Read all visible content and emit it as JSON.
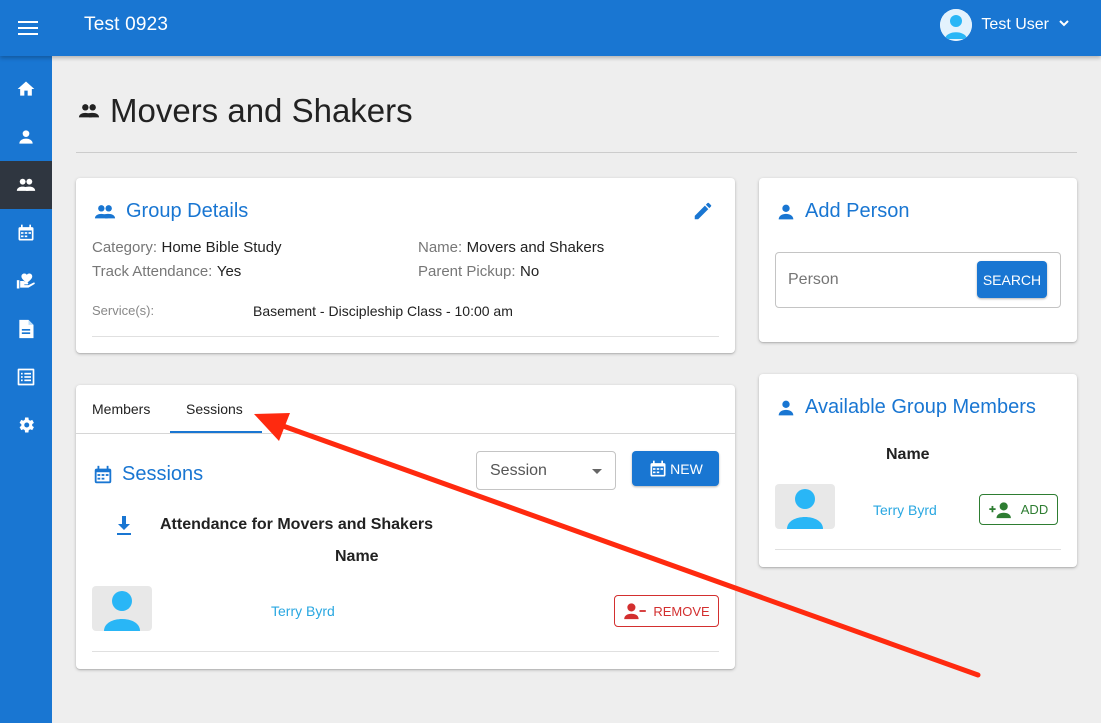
{
  "topbar": {
    "app_title": "Test 0923",
    "user_name": "Test User"
  },
  "sidebar": {
    "items": [
      {
        "name": "home",
        "active": false
      },
      {
        "name": "people",
        "active": false
      },
      {
        "name": "groups",
        "active": true
      },
      {
        "name": "attendance",
        "active": false
      },
      {
        "name": "donations",
        "active": false
      },
      {
        "name": "forms",
        "active": false
      },
      {
        "name": "reports",
        "active": false
      },
      {
        "name": "settings",
        "active": false
      }
    ]
  },
  "page": {
    "title": "Movers and Shakers"
  },
  "group_details": {
    "title": "Group Details",
    "category_label": "Category:",
    "category_value": "Home Bible Study",
    "name_label": "Name:",
    "name_value": "Movers and Shakers",
    "track_label": "Track Attendance:",
    "track_value": "Yes",
    "pickup_label": "Parent Pickup:",
    "pickup_value": "No",
    "services_label": "Service(s):",
    "services_value": "Basement - Discipleship Class - 10:00 am"
  },
  "tabs": {
    "members": "Members",
    "sessions": "Sessions",
    "active": "sessions"
  },
  "sessions_panel": {
    "title": "Sessions",
    "select_value": "Session",
    "new_label": "NEW",
    "attendance_title": "Attendance for Movers and Shakers",
    "name_header": "Name",
    "rows": [
      {
        "name": "Terry Byrd",
        "action": "REMOVE"
      }
    ]
  },
  "add_person": {
    "title": "Add Person",
    "placeholder": "Person",
    "search_label": "SEARCH"
  },
  "available_members": {
    "title": "Available Group Members",
    "name_header": "Name",
    "rows": [
      {
        "name": "Terry Byrd",
        "action": "ADD"
      }
    ]
  },
  "colors": {
    "primary": "#1976d2",
    "sidebar_active": "#2f3640",
    "link": "#29a7e1",
    "danger": "#d32f2f",
    "success": "#2e7d32",
    "annotation_arrow": "#ff2a0f"
  }
}
